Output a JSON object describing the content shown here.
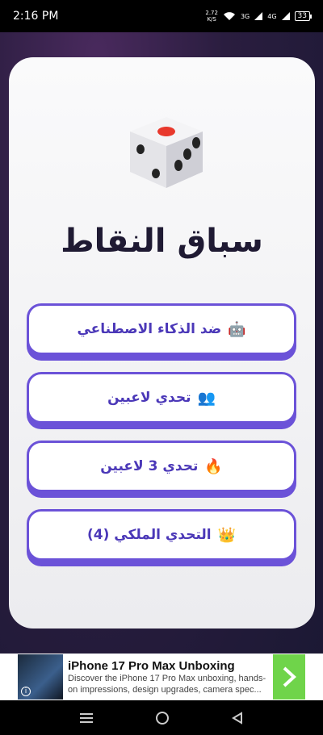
{
  "status_bar": {
    "time": "2:16 PM",
    "speed_value": "2.72",
    "speed_unit": "K/S",
    "network_1": "3G",
    "network_2": "4G",
    "battery": "33"
  },
  "game": {
    "title": "سباق النقاط",
    "dice_icon": "dice-icon"
  },
  "menu": {
    "items": [
      {
        "emoji": "🤖",
        "label": "ضد الذكاء الاصطناعي",
        "icon": "robot-icon"
      },
      {
        "emoji": "👥",
        "label": "تحدي لاعبين",
        "icon": "two-players-icon"
      },
      {
        "emoji": "🔥",
        "label": "تحدي 3 لاعبين",
        "icon": "fire-icon"
      },
      {
        "emoji": "👑",
        "label": "التحدي الملكي (4)",
        "icon": "crown-icon"
      }
    ]
  },
  "ad": {
    "title": "iPhone 17 Pro Max Unboxing",
    "description": "Discover the iPhone 17 Pro Max unboxing, hands-on impressions, design upgrades, camera spec...",
    "info_label": "i"
  },
  "colors": {
    "accent": "#6b52d8",
    "button_text": "#4b38b8",
    "title": "#1f1a33",
    "ad_arrow": "#6fd44a"
  }
}
